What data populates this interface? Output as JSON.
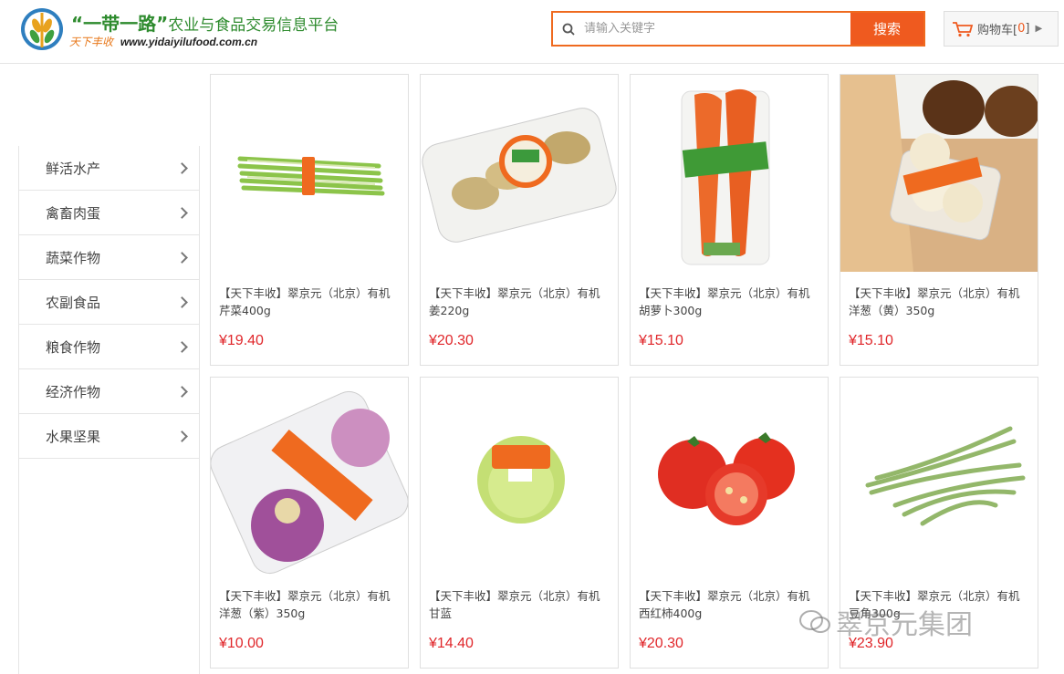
{
  "header": {
    "brand_title_quoted": "“一带一路”",
    "brand_title_rest": "农业与食品交易信息平台",
    "slogan": "天下丰收",
    "url": "www.yidaiyilufood.com.cn",
    "search_placeholder": "请输入关键字",
    "search_button": "搜索",
    "cart_label": "购物车[",
    "cart_count": "0",
    "cart_close": "]"
  },
  "sidebar": {
    "items": [
      {
        "label": "鲜活水产"
      },
      {
        "label": "禽畜肉蛋"
      },
      {
        "label": "蔬菜作物"
      },
      {
        "label": "农副食品"
      },
      {
        "label": "粮食作物"
      },
      {
        "label": "经济作物"
      },
      {
        "label": "水果坚果"
      }
    ]
  },
  "products": [
    {
      "name": "【天下丰收】翠京元（北京）有机芹菜400g",
      "price": "¥19.40",
      "icon": "celery"
    },
    {
      "name": "【天下丰收】翠京元（北京）有机姜220g",
      "price": "¥20.30",
      "icon": "ginger"
    },
    {
      "name": "【天下丰收】翠京元（北京）有机胡萝卜300g",
      "price": "¥15.10",
      "icon": "carrot"
    },
    {
      "name": "【天下丰收】翠京元（北京）有机洋葱（黄）350g",
      "price": "¥15.10",
      "icon": "yellow-onion"
    },
    {
      "name": "【天下丰收】翠京元（北京）有机洋葱（紫）350g",
      "price": "¥10.00",
      "icon": "purple-onion"
    },
    {
      "name": "【天下丰收】翠京元（北京）有机甘蓝",
      "price": "¥14.40",
      "icon": "cabbage"
    },
    {
      "name": "【天下丰收】翠京元（北京）有机西红柿400g",
      "price": "¥20.30",
      "icon": "tomato"
    },
    {
      "name": "【天下丰收】翠京元（北京）有机豆角300g",
      "price": "¥23.90",
      "icon": "green-beans"
    }
  ],
  "watermark": "翠京元集团",
  "colors": {
    "accent": "#ef5a1f",
    "price": "#e0262a",
    "brand_green": "#2e8b2e"
  }
}
